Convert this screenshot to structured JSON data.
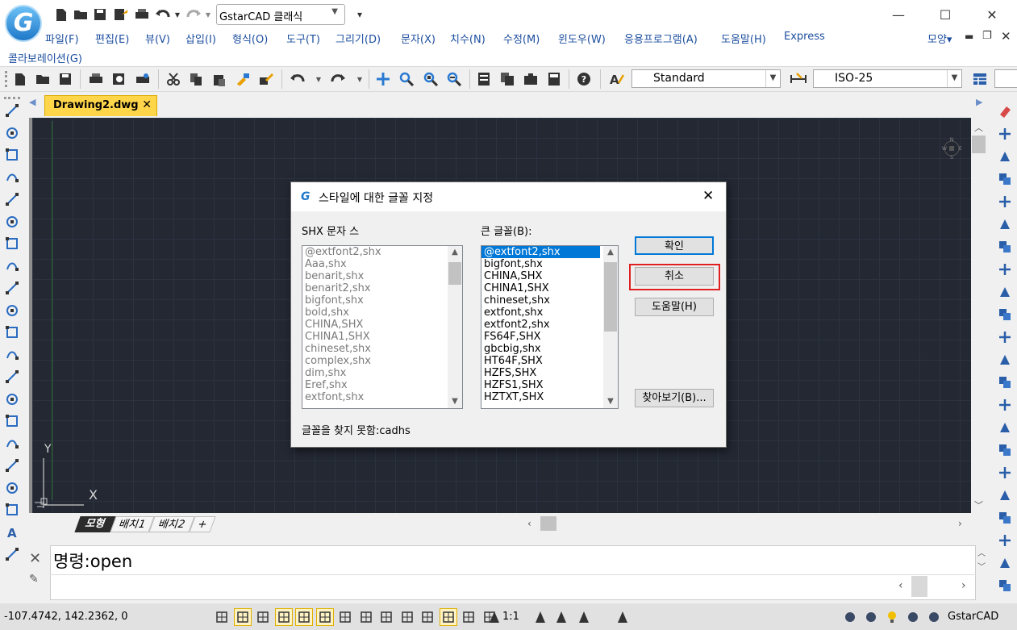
{
  "app": {
    "workspace": "GstarCAD 클래식",
    "logo_letter": "G"
  },
  "menu": {
    "items": [
      "파일(F)",
      "편집(E)",
      "뷰(V)",
      "삽입(I)",
      "형식(O)",
      "도구(T)",
      "그리기(D)",
      "문자(X)",
      "치수(N)",
      "수정(M)",
      "윈도우(W)",
      "응용프로그램(A)",
      "도움말(H)",
      "Express"
    ],
    "second_row": "콜라보레이션(G)",
    "right_label": "모양"
  },
  "toolbar": {
    "text_style": "Standard",
    "dim_style": "ISO-25"
  },
  "document": {
    "tab_label": "Drawing2.dwg",
    "layouts": [
      "모형",
      "배치1",
      "배치2",
      "+"
    ],
    "ucs_y": "Y",
    "ucs_x": "X"
  },
  "command": {
    "line": "명령:open"
  },
  "status": {
    "coords": "-107.4742, 142.2362, 0",
    "scale": "1:1",
    "brand": "GstarCAD"
  },
  "dialog": {
    "title": "스타일에 대한 글꼴 지정",
    "shx_label": "SHX 문자 스",
    "big_label": "큰 글꼴(B):",
    "shx_fonts": [
      "@extfont2,shx",
      "Aaa,shx",
      "benarit,shx",
      "benarit2,shx",
      "bigfont,shx",
      "bold,shx",
      "CHINA,SHX",
      "CHINA1,SHX",
      "chineset,shx",
      "complex,shx",
      "dim,shx",
      "Eref,shx",
      "extfont,shx"
    ],
    "big_fonts": [
      "@extfont2,shx",
      "bigfont,shx",
      "CHINA,SHX",
      "CHINA1,SHX",
      "chineset,shx",
      "extfont,shx",
      "extfont2,shx",
      "FS64F,SHX",
      "gbcbig,shx",
      "HT64F,SHX",
      "HZFS,SHX",
      "HZFS1,SHX",
      "HZTXT,SHX"
    ],
    "ok": "확인",
    "cancel": "취소",
    "help": "도움말(H)",
    "browse": "찾아보기(B)...",
    "missing": "글꼴을 찾지 못함:cadhs"
  },
  "colors": {
    "canvas": "#232833",
    "accent": "#1c4e9e",
    "tab_active": "#ffd54a",
    "highlight": "#0078d7",
    "cancel_outline": "#e02020"
  }
}
